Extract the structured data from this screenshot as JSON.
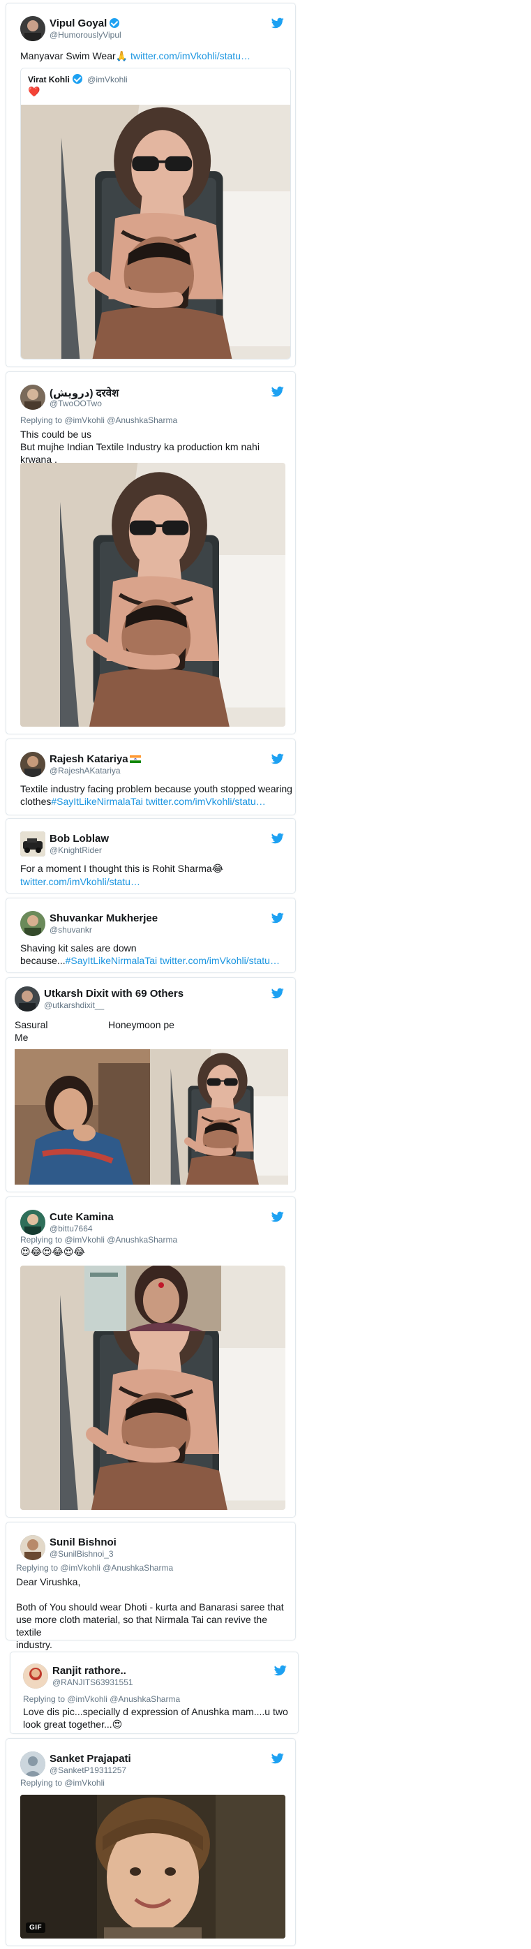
{
  "colors": {
    "link": "#1b95e0",
    "handle": "#657786",
    "border": "#e1e8ed",
    "verified": "#1da1f2"
  },
  "tweets": [
    {
      "name": "Vipul Goyal",
      "handle": "@HumorouslyVipul",
      "verified": true,
      "text": "Manyavar Swim Wear",
      "emoji": "🙏",
      "link": "twitter.com/imVkohli/statu…",
      "quote": {
        "name": "Virat Kohli",
        "handle": "@imVkohli",
        "verified": true,
        "emoji": "❤️"
      }
    },
    {
      "name": "(درویش) दरवेश",
      "handle": "@TwoOOTwo",
      "replying": "Replying to @imVkohli @AnushkaSharma",
      "line1": "This could be us",
      "line2": "But mujhe Indian Textile Industry ka production km nahi krwana ."
    },
    {
      "name": "Rajesh Katariya",
      "handle": "@RajeshAKatariya",
      "line1": "Textile industry facing problem because youth stopped wearing",
      "line2_plain": "clothes",
      "line2_hashtag": "#SayItLikeNirmalaTai",
      "line2_link": "twitter.com/imVkohli/statu…"
    },
    {
      "name": "Bob Loblaw",
      "handle": "@KnightRider",
      "line1": "For a moment I thought this is Rohit Sharma",
      "emoji": "😂",
      "link": "twitter.com/imVkohli/statu…"
    },
    {
      "name": "Shuvankar Mukherjee",
      "handle": "@shuvankr",
      "line1": "Shaving kit sales are down",
      "line2_plain": "because...",
      "line2_hashtag": "#SayItLikeNirmalaTai",
      "line2_link": "twitter.com/imVkohli/statu…"
    },
    {
      "name": "Utkarsh Dixit with 69 Others",
      "handle": "@utkarshdixit__",
      "label_left": "Sasural",
      "label_right": "Honeymoon pe",
      "label_me": "Me"
    },
    {
      "name": "Cute Kamina",
      "handle": "@bittu7664",
      "replying": "Replying to @imVkohli @AnushkaSharma",
      "emojis": "😍😂😍😂😍😂"
    },
    {
      "name": "Sunil Bishnoi",
      "handle": "@SunilBishnoi_3",
      "replying": "Replying to @imVkohli @AnushkaSharma",
      "line1": "Dear Virushka,",
      "line2": "Both of You should wear Dhoti - kurta and Banarasi saree that",
      "line3": "use more cloth material, so that Nirmala Tai can revive the textile",
      "line4": "industry."
    },
    {
      "name": "Ranjit rathore..",
      "handle": "@RANJITS63931551",
      "replying": "Replying to @imVkohli @AnushkaSharma",
      "line1": "Love dis pic...specially d expression of Anushka mam....u two",
      "line2": "look great together...",
      "emoji": "😍"
    },
    {
      "name": "Sanket Prajapati",
      "handle": "@SanketP19311257",
      "replying": "Replying to @imVkohli",
      "gif_label": "GIF"
    }
  ]
}
